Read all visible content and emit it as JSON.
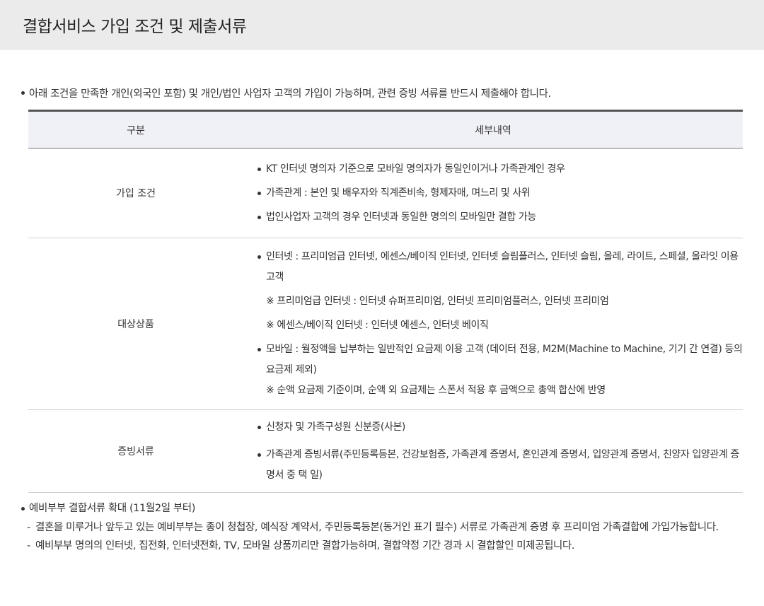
{
  "page_title": "결합서비스 가입 조건 및 제출서류",
  "intro": "아래 조건을 만족한 개인(외국인 포함) 및 개인/법인 사업자 고객의 가입이 가능하며, 관련 증빙 서류를 반드시 제출해야 합니다.",
  "table": {
    "headers": [
      "구분",
      "세부내역"
    ],
    "rows": [
      {
        "category": "가입 조건",
        "items": [
          "KT 인터넷 명의자 기준으로 모바일 명의자가 동일인이거나 가족관계인 경우",
          "가족관계 : 본인 및 배우자와 직계존비속, 형제자매, 며느리 및 사위",
          "법인사업자 고객의 경우 인터넷과 동일한 명의의 모바일만 결합 가능"
        ]
      },
      {
        "category": "대상상품",
        "internet": "인터넷 : 프리미엄급 인터넷, 에센스/베이직 인터넷, 인터넷 슬림플러스, 인터넷 슬림, 올레, 라이트, 스페셜, 올라잇 이용고객",
        "note1": "※ 프리미엄급 인터넷 : 인터넷 슈퍼프리미엄, 인터넷 프리미엄플러스, 인터넷 프리미엄",
        "note2": "※ 에센스/베이직 인터넷 : 인터넷 에센스, 인터넷 베이직",
        "mobile": "모바일 : 월정액을 납부하는 일반적인 요금제 이용 고객 (데이터 전용, M2M(Machine to Machine, 기기 간 연결) 등의 요금제 제외)",
        "note3": "※ 순액 요금제 기준이며, 순액 외 요금제는 스폰서 적용 후 금액으로 총액 합산에 반영"
      },
      {
        "category": "증빙서류",
        "items": [
          "신청자 및 가족구성원 신분증(사본)",
          "가족관계 증빙서류(주민등록등본, 건강보험증, 가족관계 증명서, 혼인관계 증명서, 입양관계 증명서, 친양자 입양관계 증명서 중 택 일)"
        ]
      }
    ]
  },
  "notice": {
    "title": "예비부부 결합서류 확대 (11월2일 부터)",
    "items": [
      "결혼을 미루거나 앞두고 있는 예비부부는 종이 청첩장, 예식장 계약서, 주민등록등본(동거인 표기 필수) 서류로 가족관계 증명 후 프리미엄 가족결합에 가입가능합니다.",
      "예비부부 명의의 인터넷, 집전화, 인터넷전화, TV, 모바일 상품끼리만 결합가능하며, 결합약정 기간 경과 시 결합할인 미제공됩니다."
    ]
  }
}
